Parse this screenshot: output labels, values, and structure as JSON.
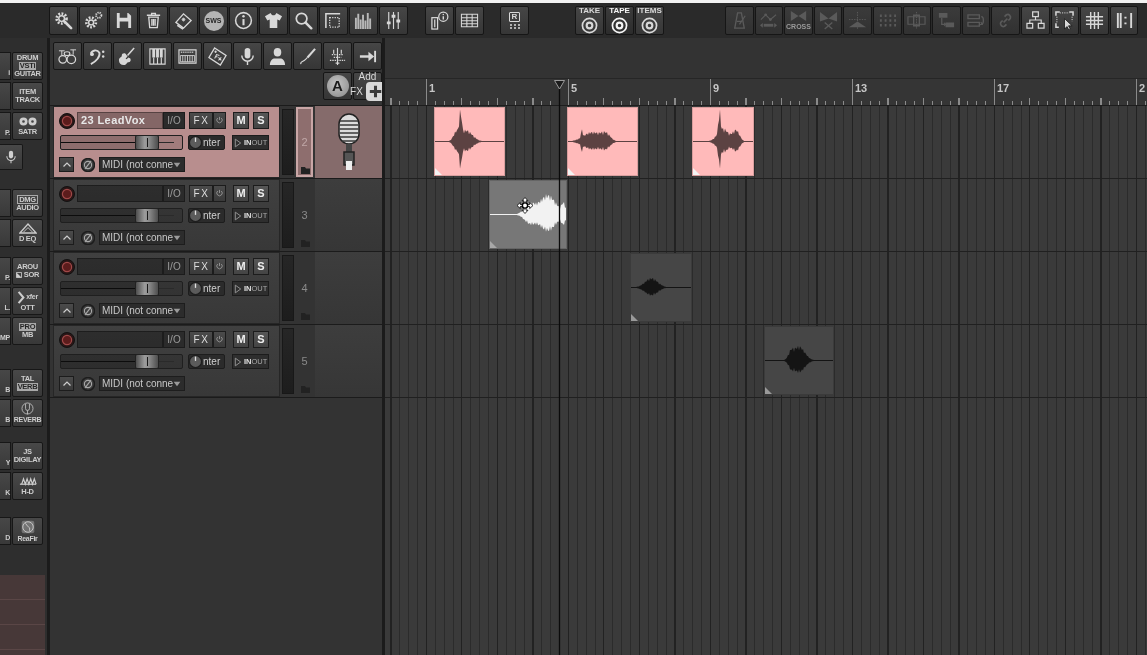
{
  "main_toolbar": {
    "groups": [
      {
        "buttons": [
          {
            "kind": "gearwrench"
          },
          {
            "kind": "gears"
          },
          {
            "kind": "floppy"
          },
          {
            "kind": "trash"
          },
          {
            "kind": "card"
          },
          {
            "kind": "badge",
            "label": "SWS"
          },
          {
            "kind": "info"
          },
          {
            "kind": "shirt"
          },
          {
            "kind": "magnifier"
          },
          {
            "kind": "crop"
          },
          {
            "kind": "spectrum"
          },
          {
            "kind": "sliders"
          }
        ]
      },
      {
        "buttons": [
          {
            "kind": "faderinfo"
          },
          {
            "kind": "table"
          }
        ]
      },
      {
        "buttons": [
          {
            "kind": "keypad",
            "label": "R"
          }
        ]
      }
    ],
    "modes": [
      {
        "label": "TAKE",
        "selected": false
      },
      {
        "label": "TAPE",
        "selected": true
      },
      {
        "label": "ITEMS",
        "selected": false
      }
    ],
    "edit_buttons": [
      {
        "kind": "metronome",
        "on": false
      },
      {
        "kind": "nodes",
        "on": false
      },
      {
        "kind": "bowtie",
        "label": "CROSS",
        "on": false
      },
      {
        "kind": "bowtiecut",
        "on": false
      },
      {
        "kind": "split",
        "on": false
      },
      {
        "kind": "dots",
        "on": false
      },
      {
        "kind": "boxcenter",
        "on": false
      },
      {
        "kind": "lanes",
        "on": false
      },
      {
        "kind": "boxarrow",
        "on": false
      },
      {
        "kind": "link",
        "on": false
      },
      {
        "kind": "orgchart",
        "on": true
      },
      {
        "kind": "marquee",
        "on": true
      },
      {
        "kind": "grid",
        "on": true
      },
      {
        "kind": "bars",
        "on": true
      }
    ]
  },
  "plugin_sidebar": {
    "groups": [
      {
        "rows": [
          {
            "kind": "text",
            "cut": "i",
            "lines": [
              {
                "text": "DRUM",
                "kind": "plain"
              },
              {
                "text": "VSTi",
                "kind": "inverse"
              },
              {
                "text": "GUITAR",
                "kind": "plain"
              }
            ]
          },
          {
            "kind": "text",
            "lines": [
              {
                "text": "ITEM",
                "kind": "plain"
              },
              {
                "text": "TRACK",
                "kind": "plain"
              }
            ]
          },
          {
            "kind": "reels",
            "cut": "P.",
            "lines": [
              {
                "text": "SATR",
                "kind": "plain"
              }
            ]
          },
          {
            "kind": "mic"
          }
        ]
      },
      {
        "rows": [
          {
            "kind": "text",
            "lines": [
              {
                "text": "DMG",
                "kind": "outline"
              },
              {
                "text": "AUDIO",
                "kind": "plain"
              }
            ]
          },
          {
            "kind": "triangle",
            "lines": [
              {
                "text": "D EQ",
                "kind": "plain"
              }
            ]
          }
        ]
      },
      {
        "rows": [
          {
            "kind": "text",
            "cut": "P.",
            "lines": [
              {
                "text": "AROU",
                "kind": "plain"
              },
              {
                "text": "SOR",
                "kind": "flagged"
              }
            ]
          },
          {
            "kind": "chevron",
            "cut": "L.",
            "lines": [
              {
                "text": "xfer",
                "kind": "small"
              },
              {
                "text": "OTT",
                "kind": "plain"
              }
            ]
          },
          {
            "kind": "text",
            "cut": "MP",
            "lines": [
              {
                "text": "PRO",
                "kind": "inverse"
              },
              {
                "text": "MB",
                "kind": "plain"
              }
            ]
          }
        ]
      },
      {
        "rows": [
          {
            "kind": "text",
            "cut": "B",
            "lines": [
              {
                "text": "TAL",
                "kind": "plain"
              },
              {
                "text": "VERB",
                "kind": "inverse"
              }
            ]
          },
          {
            "kind": "circleu",
            "cut": "B",
            "lines": [
              {
                "text": "REVERB",
                "kind": "small"
              }
            ]
          }
        ]
      },
      {
        "rows": [
          {
            "kind": "text",
            "cut": "Y",
            "lines": [
              {
                "text": "JS",
                "kind": "plain"
              },
              {
                "text": "DIGILAY",
                "kind": "plain"
              }
            ]
          },
          {
            "kind": "eqpeaks",
            "cut": "K",
            "lines": [
              {
                "text": "H-D",
                "kind": "plain"
              }
            ]
          }
        ]
      },
      {
        "rows": [
          {
            "kind": "globe",
            "cut": "D",
            "lines": [
              {
                "text": "ReaFir",
                "kind": "small"
              }
            ]
          }
        ]
      }
    ]
  },
  "track_toolbar": {
    "buttons": [
      {
        "kind": "drums"
      },
      {
        "kind": "clef"
      },
      {
        "kind": "guitar"
      },
      {
        "kind": "piano"
      },
      {
        "kind": "synth"
      },
      {
        "kind": "tag"
      },
      {
        "kind": "mic"
      },
      {
        "kind": "bust"
      },
      {
        "kind": "cable"
      },
      {
        "kind": "fork"
      },
      {
        "kind": "arrowbar"
      }
    ],
    "letter_button": {
      "label": "A"
    },
    "add_fx": {
      "lines": [
        "Add",
        "FX"
      ]
    }
  },
  "tracks": [
    {
      "number": "2",
      "name": "23 LeadVox",
      "color": "#ffbaba",
      "selected": true,
      "armed": false,
      "io": "I/O",
      "fx": "FX",
      "mute": {
        "label": "M",
        "on": false
      },
      "solo": {
        "label": "S",
        "on": false
      },
      "fader": {
        "level": 0.71
      },
      "pan_label": "nter",
      "monitor": {
        "in": "IN",
        "out": "OUT"
      },
      "midi_input": "MIDI (not conne",
      "has_icon": true,
      "items": [
        {
          "selected": false
        },
        {
          "selected": false
        },
        {
          "selected": false
        }
      ]
    },
    {
      "number": "3",
      "selected": false,
      "armed": false,
      "io": "I/O",
      "fx": "FX",
      "mute": {
        "label": "M",
        "on": false
      },
      "solo": {
        "label": "S",
        "on": false
      },
      "fader": {
        "level": 0.71
      },
      "pan_label": "nter",
      "monitor": {
        "in": "IN",
        "out": "OUT"
      },
      "midi_input": "MIDI (not conne",
      "has_icon": false,
      "items": [
        {
          "selected": true
        }
      ]
    },
    {
      "number": "4",
      "selected": false,
      "armed": false,
      "io": "I/O",
      "fx": "FX",
      "mute": {
        "label": "M",
        "on": false
      },
      "solo": {
        "label": "S",
        "on": false
      },
      "fader": {
        "level": 0.71
      },
      "pan_label": "nter",
      "monitor": {
        "in": "IN",
        "out": "OUT"
      },
      "midi_input": "MIDI (not conne",
      "has_icon": false,
      "items": [
        {
          "selected": false
        }
      ]
    },
    {
      "number": "5",
      "selected": false,
      "armed": false,
      "io": "I/O",
      "fx": "FX",
      "mute": {
        "label": "M",
        "on": false
      },
      "solo": {
        "label": "S",
        "on": false
      },
      "fader": {
        "level": 0.71
      },
      "pan_label": "nter",
      "monitor": {
        "in": "IN",
        "out": "OUT"
      },
      "midi_input": "MIDI (not conne",
      "has_icon": false,
      "items": [
        {
          "selected": false
        }
      ]
    }
  ],
  "ruler": {
    "labels": [
      "1",
      "5",
      "9",
      "13",
      "17",
      "2"
    ]
  }
}
